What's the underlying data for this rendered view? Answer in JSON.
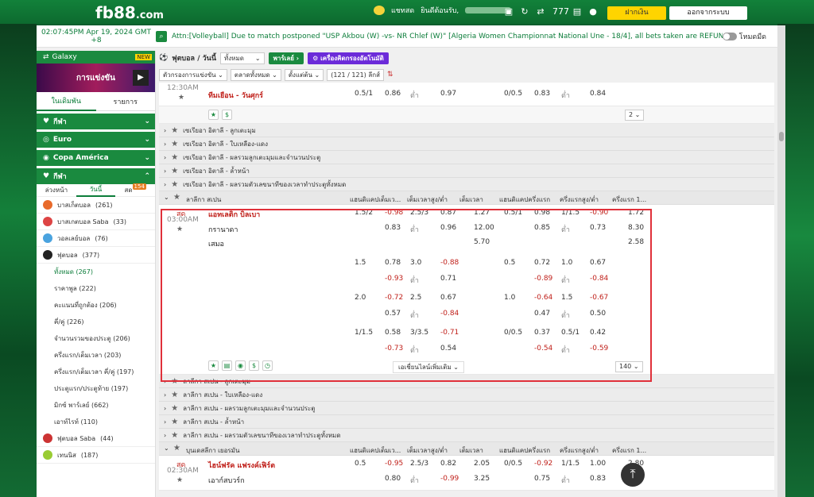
{
  "header": {
    "logo": "fb88",
    "logo_suffix": ".com",
    "chat": "แชทสด",
    "welcome": "ยินดีต้อนรับ,",
    "deposit": "ฝากเงิน",
    "logout": "ออกจากระบบ"
  },
  "ticker": {
    "time": "02:07:45PM Apr 19, 2024 GMT +8",
    "news": "Attn:[Volleyball] Due to match postponed \"USP Akbou (W) -vs- NR Chlef (W)\" [Algeria Women Championnat National Une - 18/4], all bets taken are refunded.",
    "news_full": "Attn:[Volleyball] Due to match postponed \"USP Akbou (W) -vs- NR Chlef (W)\" [Algeria Women Championnat National Une - 18/4], all bets taken are REFUNDED.",
    "darkmode": "โหมดมืด"
  },
  "sidebar": {
    "galaxy": "Galaxy",
    "new_badge": "NEW",
    "banner_text": "การแข่งขัน",
    "tab_mybets": "ในเดิมพัน",
    "tab_list": "รายการ",
    "cats": [
      "กีฬา",
      "Euro",
      "Copa América",
      "กีฬา"
    ],
    "subtabs": [
      "ล่วงหน้า",
      "วันนี้",
      "สด"
    ],
    "live_count": "154",
    "sports": [
      {
        "name": "บาสเก็ตบอล",
        "count": "(261)"
      },
      {
        "name": "บาสเกตบอล Saba",
        "count": "(33)"
      },
      {
        "name": "วอลเลย์บอล",
        "count": "(76)"
      },
      {
        "name": "ฟุตบอล",
        "count": "(377)"
      }
    ],
    "football_items": [
      "ทั้งหมด (267)",
      "ราคาพูล (222)",
      "คะแนนที่ถูกต้อง (206)",
      "คี่/คู่ (226)",
      "จำนวนรวมของประตู (206)",
      "ครึ่งแรก/เต็มเวลา (203)",
      "ครึ่งแรก/เต็มเวลา คี่/คู่ (197)",
      "ประตูแรก/ประตูท้าย (197)",
      "มิกซ์ พาร์เลย์ (662)",
      "เอาท์ไรท์ (110)"
    ],
    "sports2": [
      {
        "name": "ฟุตบอล Saba",
        "count": "(44)"
      },
      {
        "name": "เทนนิส",
        "count": "(187)"
      }
    ]
  },
  "toolbar": {
    "title": "ฟุตบอล / วันนี้",
    "all": "ทั้งหมด",
    "parlay": "พาร์เลย์",
    "lucky": "เครื่องคิดกรองอัตโนมัติ",
    "f1": "ตัวกรองการแข่งขัน",
    "f2": "ตลาดทั้งหมด",
    "f3": "ตั้งแต่ต้น",
    "f4": "(121 / 121) ลีกส์"
  },
  "match0": {
    "time": "12:30AM",
    "draw": "ทีมเยือน - วันศุกร์",
    "o1": "0.5/1",
    "o2": "0.86",
    "o3": "ต่ำ",
    "o4": "0.97",
    "o5": "0/0.5",
    "o6": "0.83",
    "o7": "ต่ำ",
    "o8": "0.84",
    "pager": "2"
  },
  "leagues1": [
    "เซเรียอา อิตาลี - ลูกเตะมุม",
    "เซเรียอา อิตาลี - ใบเหลือง-แดง",
    "เซเรียอา อิตาลี - ผลรวมลูกเตะมุมและจำนวนประตู",
    "เซเรียอา อิตาลี - ล้ำหน้า",
    "เซเรียอา อิตาลี - ผลรวมตัวเลขนาทีของเวลาทำประตูทั้งหมด"
  ],
  "laliga": {
    "name": "ลาลีกา สเปน",
    "h1": "แฮนดิแคปเต็มเว...",
    "h2": "เต็มเวลาสูง/ต่ำ",
    "h3": "เต็มเวลา",
    "h4": "แฮนดิแคปครึ่งแรก",
    "h5": "ครึ่งแรกสูง/ต่ำ",
    "h6": "ครึ่งแรก 1..."
  },
  "match1": {
    "live": "สด",
    "time": "03:00AM",
    "home": "แอทเลติก บิลเบา",
    "away": "กรานาดา",
    "draw": "เสมอ",
    "more": "เอเชี่ยนไลน์เพิ่มเติม",
    "pager": "140",
    "lines": [
      [
        "1.5/2",
        "-0.98",
        "2.5/3",
        "0.87",
        "1.27",
        "0.5/1",
        "0.98",
        "1/1.5",
        "-0.90",
        "1.72"
      ],
      [
        "",
        "0.83",
        "ต่ำ",
        "0.96",
        "12.00",
        "",
        "0.85",
        "ต่ำ",
        "0.73",
        "8.30"
      ],
      [
        "",
        "",
        "",
        "",
        "5.70",
        "",
        "",
        "",
        "",
        "2.58"
      ],
      [
        "1.5",
        "0.78",
        "3.0",
        "-0.88",
        "",
        "0.5",
        "0.72",
        "1.0",
        "0.67",
        ""
      ],
      [
        "",
        "-0.93",
        "ต่ำ",
        "0.71",
        "",
        "",
        "-0.89",
        "ต่ำ",
        "-0.84",
        ""
      ],
      [
        "2.0",
        "-0.72",
        "2.5",
        "0.67",
        "",
        "1.0",
        "-0.64",
        "1.5",
        "-0.67",
        ""
      ],
      [
        "",
        "0.57",
        "ต่ำ",
        "-0.84",
        "",
        "",
        "0.47",
        "ต่ำ",
        "0.50",
        ""
      ],
      [
        "1/1.5",
        "0.58",
        "3/3.5",
        "-0.71",
        "",
        "0/0.5",
        "0.37",
        "0.5/1",
        "0.42",
        ""
      ],
      [
        "",
        "-0.73",
        "ต่ำ",
        "0.54",
        "",
        "",
        "-0.54",
        "ต่ำ",
        "-0.59",
        ""
      ]
    ]
  },
  "leagues2": [
    "ลาลีกา สเปน - ลูกเตะมุม",
    "ลาลีกา สเปน - ใบเหลือง-แดง",
    "ลาลีกา สเปน - ผลรวมลูกเตะมุมและจำนวนประตู",
    "ลาลีกา สเปน - ล้ำหน้า",
    "ลาลีกา สเปน - ผลรวมตัวเลขนาทีของเวลาทำประตูทั้งหมด"
  ],
  "bundes": {
    "name": "บุนเดสลีกา เยอรมัน",
    "h1": "แฮนดิแคปเต็มเว...",
    "h2": "เต็มเวลาสูง/ต่ำ",
    "h3": "เต็มเวลา",
    "h4": "แฮนดิแคปครึ่งแรก",
    "h5": "ครึ่งแรกสูง/ต่ำ",
    "h6": "ครึ่งแรก 1..."
  },
  "match2": {
    "live": "สด",
    "time": "02:30AM",
    "home": "ไฮน์ฟรัค แฟรงค์เฟิร์ต",
    "away": "เอาก์สบวร์ก",
    "l1": [
      "0.5",
      "-0.95",
      "2.5/3",
      "0.82",
      "2.05",
      "0/0.5",
      "-0.92",
      "1/1.5",
      "1.00",
      "2.80"
    ],
    "l2": [
      "",
      "0.80",
      "ต่ำ",
      "-0.99",
      "3.25",
      "",
      "0.75",
      "ต่ำ",
      "0.83",
      "3.70"
    ]
  }
}
